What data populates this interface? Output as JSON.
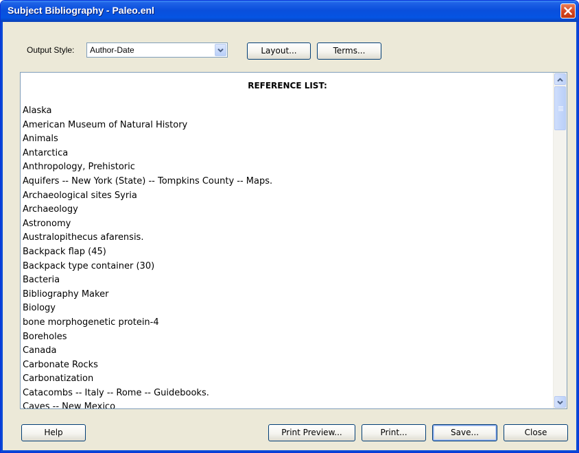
{
  "window": {
    "title": "Subject Bibliography - Paleo.enl",
    "close_icon": "close-icon"
  },
  "toolbar": {
    "output_style_label": "Output Style:",
    "output_style_value": "Author-Date",
    "layout_button": "Layout...",
    "terms_button": "Terms..."
  },
  "reference": {
    "title": "REFERENCE LIST:",
    "items": [
      "Alaska",
      "American Museum of Natural History",
      "Animals",
      "Antarctica",
      "Anthropology, Prehistoric",
      "Aquifers -- New York (State) -- Tompkins County -- Maps.",
      "Archaeological sites Syria",
      "Archaeology",
      "Astronomy",
      "Australopithecus afarensis.",
      "Backpack flap (45)",
      "Backpack type container (30)",
      "Bacteria",
      "Bibliography Maker",
      "Biology",
      "bone morphogenetic protein-4",
      "Boreholes",
      "Canada",
      "Carbonate Rocks",
      "Carbonatization",
      "Catacombs -- Italy -- Rome -- Guidebooks.",
      "Caves -- New Mexico"
    ]
  },
  "footer": {
    "help_button": "Help",
    "print_preview_button": "Print Preview...",
    "print_button": "Print...",
    "save_button": "Save...",
    "close_button": "Close"
  },
  "colors": {
    "titlebar_blue": "#0a4fdc",
    "dialog_background": "#ece9d8",
    "close_red": "#d4441f"
  }
}
